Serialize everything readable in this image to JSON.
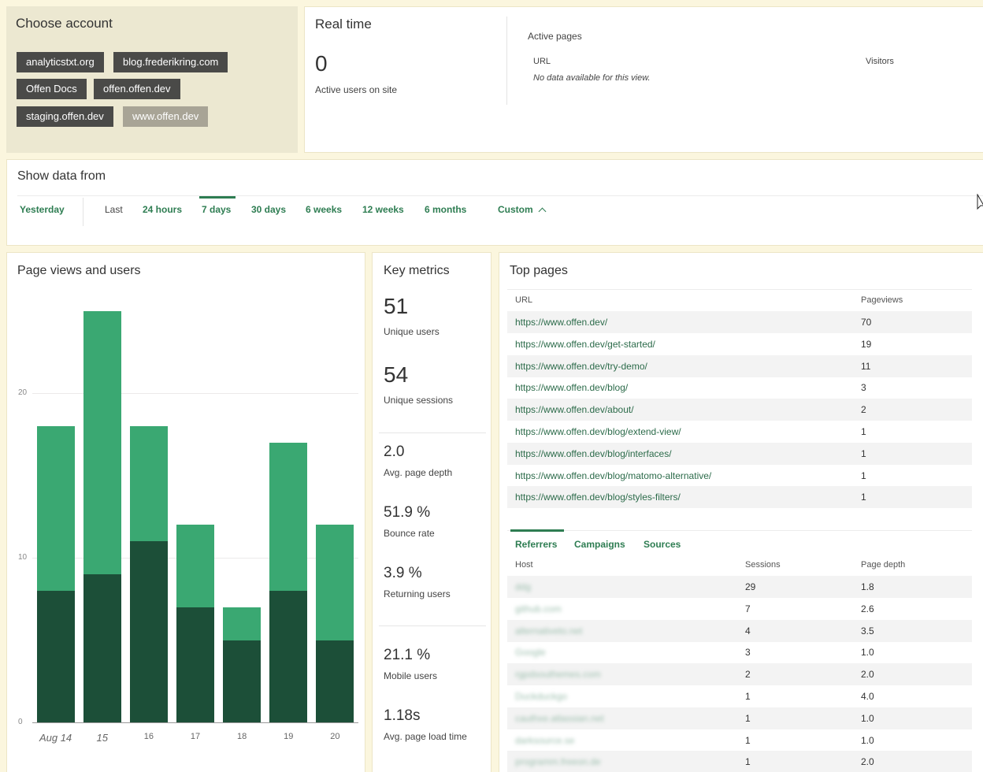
{
  "choose_account": {
    "title": "Choose account",
    "accounts": [
      {
        "label": "analyticstxt.org",
        "selected": false
      },
      {
        "label": "blog.frederikring.com",
        "selected": false
      },
      {
        "label": "Offen Docs",
        "selected": false
      },
      {
        "label": "offen.offen.dev",
        "selected": false
      },
      {
        "label": "staging.offen.dev",
        "selected": false
      },
      {
        "label": "www.offen.dev",
        "selected": true
      }
    ]
  },
  "real_time": {
    "title": "Real time",
    "active_users": "0",
    "active_users_label": "Active users on site",
    "active_pages_title": "Active pages",
    "col_url": "URL",
    "col_visitors": "Visitors",
    "empty_text": "No data available for this view."
  },
  "show_data": {
    "title": "Show data from",
    "yesterday": "Yesterday",
    "last_label": "Last",
    "ranges": [
      "24 hours",
      "7 days",
      "30 days",
      "6 weeks",
      "12 weeks",
      "6 months"
    ],
    "active_range": "7 days",
    "custom": "Custom"
  },
  "chart": {
    "title": "Page views and users"
  },
  "chart_data": {
    "type": "bar",
    "categories": [
      "Aug 14",
      "15",
      "16",
      "17",
      "18",
      "19",
      "20"
    ],
    "series": [
      {
        "values": [
          8,
          9,
          11,
          7,
          5,
          8,
          5
        ]
      },
      {
        "values": [
          18,
          25,
          18,
          12,
          7,
          17,
          12
        ]
      }
    ],
    "yticks": [
      "0",
      "10",
      "20"
    ],
    "ylim": [
      0,
      25
    ],
    "stacked_overlay": true,
    "colors": {
      "dark": "#1c4f38",
      "light": "#3aa872"
    }
  },
  "key_metrics": {
    "title": "Key metrics",
    "items": [
      {
        "value": "51",
        "label": "Unique users"
      },
      {
        "value": "54",
        "label": "Unique sessions"
      },
      {
        "value": "2.0",
        "label": "Avg. page depth"
      },
      {
        "value": "51.9 %",
        "label": "Bounce rate"
      },
      {
        "value": "3.9 %",
        "label": "Returning users"
      },
      {
        "value": "21.1 %",
        "label": "Mobile users"
      },
      {
        "value": "1.18s",
        "label": "Avg. page load time"
      }
    ]
  },
  "top_pages": {
    "title": "Top pages",
    "col_url": "URL",
    "col_pageviews": "Pageviews",
    "rows": [
      {
        "url": "https://www.offen.dev/",
        "views": "70"
      },
      {
        "url": "https://www.offen.dev/get-started/",
        "views": "19"
      },
      {
        "url": "https://www.offen.dev/try-demo/",
        "views": "11"
      },
      {
        "url": "https://www.offen.dev/blog/",
        "views": "3"
      },
      {
        "url": "https://www.offen.dev/about/",
        "views": "2"
      },
      {
        "url": "https://www.offen.dev/blog/extend-view/",
        "views": "1"
      },
      {
        "url": "https://www.offen.dev/blog/interfaces/",
        "views": "1"
      },
      {
        "url": "https://www.offen.dev/blog/matomo-alternative/",
        "views": "1"
      },
      {
        "url": "https://www.offen.dev/blog/styles-filters/",
        "views": "1"
      }
    ]
  },
  "referrers": {
    "tabs": [
      "Referrers",
      "Campaigns",
      "Sources"
    ],
    "col_host": "Host",
    "col_sessions": "Sessions",
    "col_depth": "Page depth",
    "rows": [
      {
        "host": "ddg",
        "sessions": "29",
        "depth": "1.8"
      },
      {
        "host": "github.com",
        "sessions": "7",
        "depth": "2.6"
      },
      {
        "host": "alternativeto.net",
        "sessions": "4",
        "depth": "3.5"
      },
      {
        "host": "Google",
        "sessions": "3",
        "depth": "1.0"
      },
      {
        "host": "rgpdsouthemes.com",
        "sessions": "2",
        "depth": "2.0"
      },
      {
        "host": "Duckduckgo",
        "sessions": "1",
        "depth": "4.0"
      },
      {
        "host": "cauthxe.atlassian.net",
        "sessions": "1",
        "depth": "1.0"
      },
      {
        "host": "darksource.se",
        "sessions": "1",
        "depth": "1.0"
      },
      {
        "host": "programm.freeon.de",
        "sessions": "1",
        "depth": "2.0"
      }
    ]
  }
}
